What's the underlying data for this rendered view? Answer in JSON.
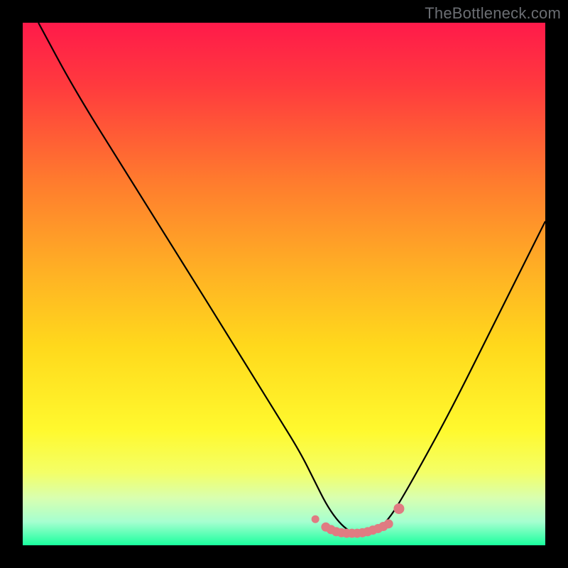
{
  "watermark": "TheBottleneck.com",
  "colors": {
    "frame": "#000000",
    "curve": "#000000",
    "marker_fill": "#e07b82",
    "marker_stroke": "#e07b82",
    "gradient_stops": [
      {
        "offset": 0.0,
        "color": "#ff1a4a"
      },
      {
        "offset": 0.12,
        "color": "#ff3a3e"
      },
      {
        "offset": 0.3,
        "color": "#ff7a2e"
      },
      {
        "offset": 0.48,
        "color": "#ffb224"
      },
      {
        "offset": 0.62,
        "color": "#ffd91c"
      },
      {
        "offset": 0.78,
        "color": "#fff92e"
      },
      {
        "offset": 0.86,
        "color": "#f4ff66"
      },
      {
        "offset": 0.91,
        "color": "#d8ffb0"
      },
      {
        "offset": 0.955,
        "color": "#a6ffd0"
      },
      {
        "offset": 1.0,
        "color": "#1aff9e"
      }
    ]
  },
  "chart_data": {
    "type": "line",
    "title": "",
    "xlabel": "",
    "ylabel": "",
    "xlim": [
      0,
      100
    ],
    "ylim": [
      0,
      100
    ],
    "grid": false,
    "series": [
      {
        "name": "curve",
        "x": [
          3,
          10,
          20,
          30,
          40,
          48,
          53,
          56,
          58,
          60,
          62,
          64,
          66,
          68,
          70,
          72,
          76,
          82,
          90,
          100
        ],
        "y": [
          100,
          87,
          71,
          55,
          39,
          26,
          18,
          12,
          8,
          5,
          3,
          2,
          2,
          3,
          5,
          8,
          15,
          26,
          42,
          62
        ]
      }
    ],
    "markers": {
      "name": "valley-band",
      "x": [
        56,
        58,
        59,
        60,
        61,
        62,
        63,
        64,
        65,
        66,
        67,
        68,
        69,
        70,
        72
      ],
      "y": [
        5,
        3.5,
        3,
        2.6,
        2.4,
        2.3,
        2.3,
        2.3,
        2.4,
        2.6,
        2.9,
        3.2,
        3.6,
        4.1,
        7
      ],
      "radius": [
        5,
        6,
        6,
        6,
        6,
        6,
        6,
        6,
        6,
        6,
        6,
        6,
        6,
        6,
        7
      ]
    }
  }
}
